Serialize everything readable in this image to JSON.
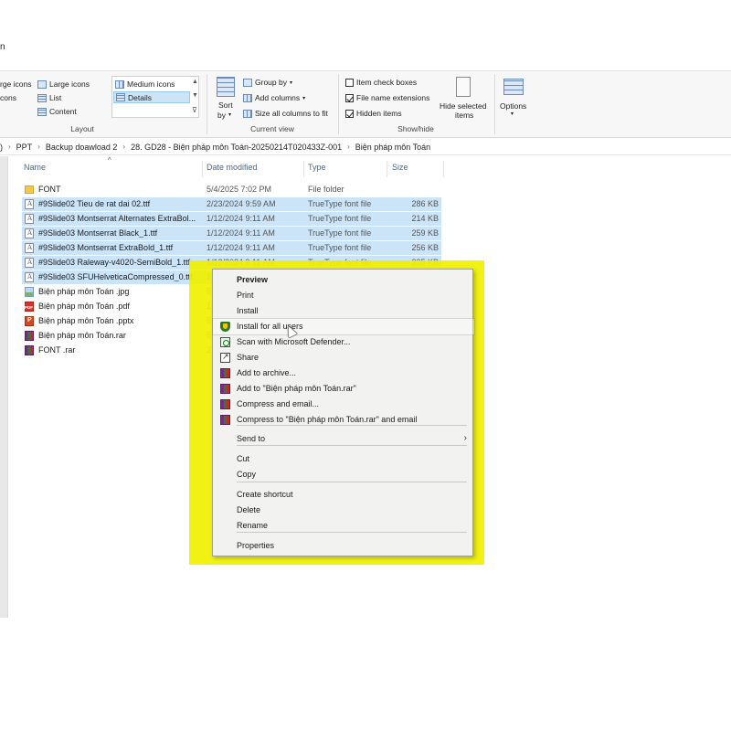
{
  "window": {
    "title_fragment": "n"
  },
  "ribbon": {
    "layout": {
      "items": [
        "rge icons",
        "Large icons",
        "Medium icons",
        "cons",
        "List",
        "Details",
        "Content"
      ],
      "group_label": "Layout"
    },
    "current_view": {
      "sort_label_1": "Sort",
      "sort_label_2": "by",
      "group_by": "Group by",
      "add_columns": "Add columns",
      "size_all_columns": "Size all columns to fit",
      "group_label": "Current view"
    },
    "show_hide": {
      "item_check_boxes": {
        "label": "Item check boxes",
        "checked": false
      },
      "file_name_extensions": {
        "label": "File name extensions",
        "checked": true
      },
      "hidden_items": {
        "label": "Hidden items",
        "checked": true
      },
      "hide_selected_1": "Hide selected",
      "hide_selected_2": "items",
      "group_label": "Show/hide"
    },
    "options": {
      "label": "Options"
    }
  },
  "address": {
    "prefix": ")",
    "crumbs": [
      "PPT",
      "Backup doawload 2",
      "28. GD28 - Biện pháp môn Toán-20250214T020433Z-001",
      "Biện pháp môn Toán"
    ]
  },
  "columns": {
    "name": "Name",
    "date": "Date modified",
    "type": "Type",
    "size": "Size"
  },
  "files": [
    {
      "name": "FONT",
      "date": "5/4/2025 7:02 PM",
      "type": "File folder",
      "size": "",
      "icon": "folder-icon",
      "selected": false
    },
    {
      "name": "#9Slide02 Tieu de rat dai 02.ttf",
      "date": "2/23/2024 9:59 AM",
      "type": "TrueType font file",
      "size": "286 KB",
      "icon": "font-file-icon",
      "selected": true
    },
    {
      "name": "#9Slide03 Montserrat Alternates ExtraBol...",
      "date": "1/12/2024 9:11 AM",
      "type": "TrueType font file",
      "size": "214 KB",
      "icon": "font-file-icon",
      "selected": true
    },
    {
      "name": "#9Slide03 Montserrat Black_1.ttf",
      "date": "1/12/2024 9:11 AM",
      "type": "TrueType font file",
      "size": "259 KB",
      "icon": "font-file-icon",
      "selected": true
    },
    {
      "name": "#9Slide03 Montserrat ExtraBold_1.ttf",
      "date": "1/12/2024 9:11 AM",
      "type": "TrueType font file",
      "size": "256 KB",
      "icon": "font-file-icon",
      "selected": true
    },
    {
      "name": "#9Slide03 Raleway-v4020-SemiBold_1.ttf",
      "date": "1/12/2024 9:11 AM",
      "type": "TrueType font file",
      "size": "335 KB",
      "icon": "font-file-icon",
      "selected": true
    },
    {
      "name": "#9Slide03 SFUHelveticaCompressed_0.ttf",
      "date": "1",
      "type": "",
      "size": "",
      "icon": "font-file-icon",
      "selected": true
    },
    {
      "name": "Biện pháp môn Toán .jpg",
      "date": "5",
      "type": "",
      "size": "",
      "icon": "jpg-file-icon",
      "selected": false
    },
    {
      "name": "Biện pháp môn Toán .pdf",
      "date": "1",
      "type": "",
      "size": "",
      "icon": "pdf-file-icon",
      "selected": false
    },
    {
      "name": "Biện pháp môn Toán .pptx",
      "date": "5",
      "type": "",
      "size": "",
      "icon": "pptx-file-icon",
      "selected": false
    },
    {
      "name": "Biện pháp môn Toán.rar",
      "date": "5",
      "type": "",
      "size": "",
      "icon": "rar-file-icon",
      "selected": false
    },
    {
      "name": "FONT .rar",
      "date": "2",
      "type": "",
      "size": "",
      "icon": "rar-file-icon",
      "selected": false
    }
  ],
  "context_menu": {
    "items": [
      {
        "label": "Preview",
        "bold": true,
        "icon": ""
      },
      {
        "label": "Print",
        "icon": ""
      },
      {
        "label": "Install",
        "icon": ""
      },
      {
        "label": "Install for all users",
        "icon": "admin-shield-icon",
        "hover": true
      },
      {
        "label": "Scan with Microsoft Defender...",
        "icon": "defender-icon"
      },
      {
        "label": "Share",
        "icon": "share-icon"
      },
      {
        "label": "Add to archive...",
        "icon": "winrar-icon"
      },
      {
        "label": "Add to \"Biện pháp môn Toán.rar\"",
        "icon": "winrar-icon"
      },
      {
        "label": "Compress and email...",
        "icon": "winrar-icon"
      },
      {
        "label": "Compress to \"Biện pháp môn Toán.rar\" and email",
        "icon": "winrar-icon"
      },
      {
        "label": "Send to",
        "icon": "",
        "submenu": true
      },
      {
        "label": "Cut",
        "icon": ""
      },
      {
        "label": "Copy",
        "icon": ""
      },
      {
        "label": "Create shortcut",
        "icon": ""
      },
      {
        "label": "Delete",
        "icon": ""
      },
      {
        "label": "Rename",
        "icon": ""
      },
      {
        "label": "Properties",
        "icon": ""
      }
    ],
    "highlight_color": "#f0f000"
  },
  "colors": {
    "selection": "#cce4f7",
    "accent": "#0078d7",
    "highlight": "#f0f000"
  }
}
